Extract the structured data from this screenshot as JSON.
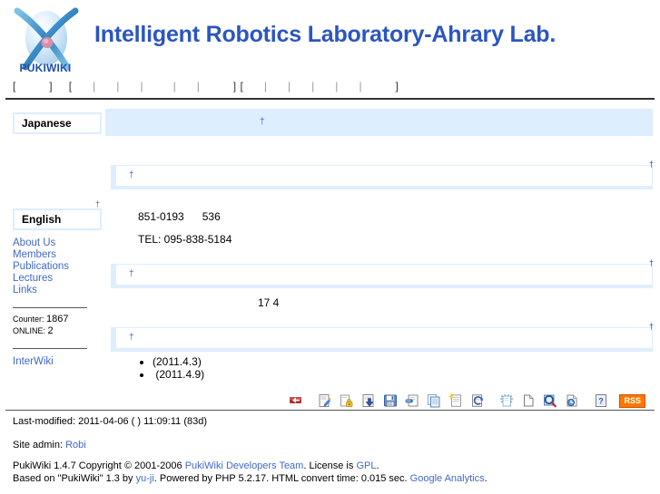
{
  "header": {
    "logo_text": "PUKIWIKI",
    "site_title": "Intelligent Robotics Laboratory-Ahrary Lab."
  },
  "navbar": {
    "open_bracket": "[",
    "close_bracket": "]",
    "separator": "|",
    "items": [
      {
        "label": "",
        "name": "nav-top"
      },
      {
        "label": "",
        "name": "nav-new"
      },
      {
        "label": "",
        "name": "nav-edit"
      },
      {
        "label": "",
        "name": "nav-freeze"
      },
      {
        "label": "",
        "name": "nav-diff"
      },
      {
        "label": "",
        "name": "nav-backup"
      },
      {
        "label": "",
        "name": "nav-upload"
      },
      {
        "label": "",
        "name": "nav-copy"
      },
      {
        "label": "",
        "name": "nav-rename"
      },
      {
        "label": "",
        "name": "nav-reload"
      },
      {
        "label": "",
        "name": "nav-list"
      },
      {
        "label": "",
        "name": "nav-search"
      },
      {
        "label": "",
        "name": "nav-recent"
      },
      {
        "label": "",
        "name": "nav-help"
      }
    ]
  },
  "sidebar": {
    "japanese_heading": "Japanese",
    "english_heading": "English",
    "anchor_mark": "†",
    "links": [
      {
        "label": "About Us"
      },
      {
        "label": "Members"
      },
      {
        "label": "Publications"
      },
      {
        "label": "Lectures"
      },
      {
        "label": "Links"
      }
    ],
    "counter_label": "Counter:",
    "counter_value": "1867",
    "online_label": "ONLINE:",
    "online_value": "2",
    "interwiki_label": "InterWiki"
  },
  "main": {
    "anchor_mark": "†",
    "heading1": "",
    "heading2": "",
    "heading3": "",
    "heading4": "",
    "address_line": "851-0193      536",
    "tel_line": "TEL: 095-838-5184",
    "date_line": "17 4",
    "news": [
      {
        "label": "(2011.4.3)"
      },
      {
        "label": " (2011.4.9)"
      }
    ]
  },
  "toolbar": {
    "rss_label": "RSS",
    "icons": [
      {
        "name": "top-icon",
        "title": "Top"
      },
      {
        "name": "edit-icon",
        "title": "Edit"
      },
      {
        "name": "freeze-icon",
        "title": "Freeze"
      },
      {
        "name": "diff-icon",
        "title": "Diff"
      },
      {
        "name": "backup-icon",
        "title": "Backup"
      },
      {
        "name": "upload-icon",
        "title": "Upload"
      },
      {
        "name": "copy-icon",
        "title": "Copy"
      },
      {
        "name": "new-icon",
        "title": "New"
      },
      {
        "name": "rename-icon",
        "title": "Rename"
      },
      {
        "name": "reload-icon",
        "title": "Reload"
      },
      {
        "name": "attach-icon",
        "title": "Attach"
      },
      {
        "name": "search-icon",
        "title": "Search"
      },
      {
        "name": "recent-icon",
        "title": "Recent changes"
      },
      {
        "name": "help-icon",
        "title": "Help"
      }
    ]
  },
  "footer": {
    "last_modified": "Last-modified: 2011-04-06 ( ) 11:09:11 (83d)",
    "site_admin_label": "Site admin:",
    "site_admin_name": "Robi",
    "copyright_line1_pre": "PukiWiki 1.4.7 Copyright © 2001-2006",
    "copyright_dev_team": "PukiWiki Developers Team",
    "copyright_license_pre": ". License is",
    "copyright_license": "GPL",
    "copyright_line1_post": ".",
    "copyright_line2_pre": "Based on \"PukiWiki\" 1.3 by",
    "copyright_author": "yu-ji",
    "copyright_line2_mid": ". Powered by PHP 5.2.17. HTML convert time: 0.015 sec.",
    "copyright_analytics": "Google Analytics",
    "copyright_line2_post": "."
  },
  "colors": {
    "title_blue": "#2b56c0",
    "link_blue": "#4169c8",
    "heading_bg": "#ddeeff",
    "rss_orange": "#ff7700"
  }
}
